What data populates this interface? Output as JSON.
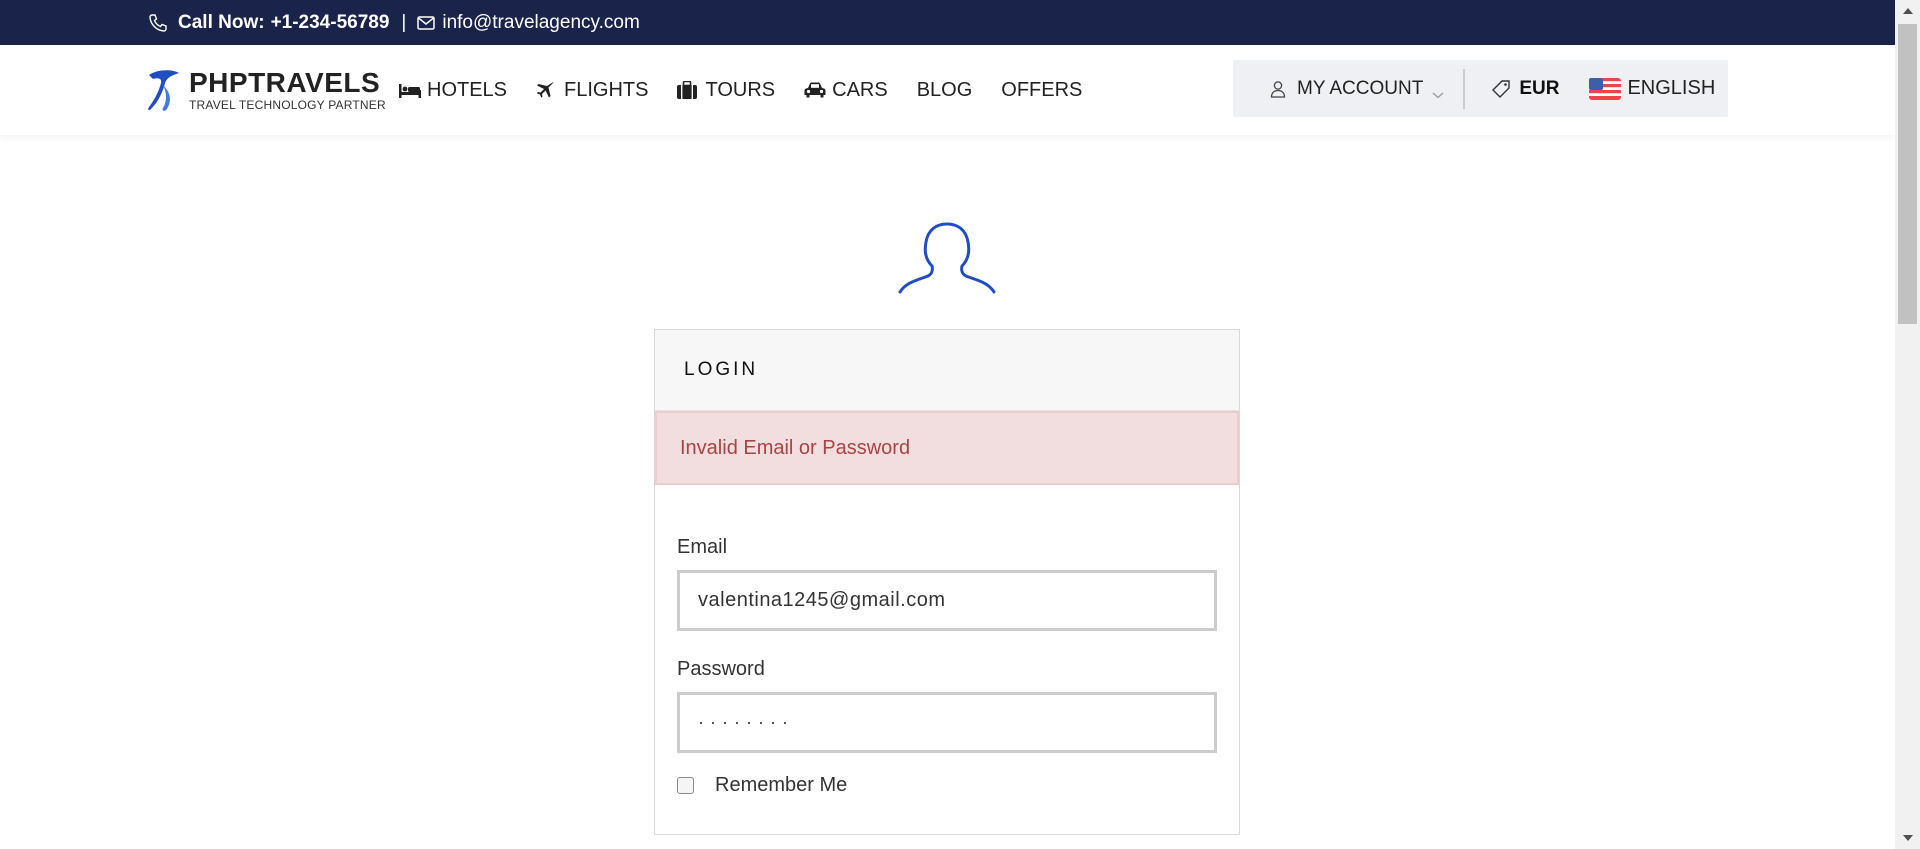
{
  "topbar": {
    "call_label": "Call Now:",
    "phone": "+1-234-56789",
    "separator": "|",
    "email": "info@travelagency.com"
  },
  "logo": {
    "name": "PHPTRAVELS",
    "tagline": "TRAVEL TECHNOLOGY PARTNER"
  },
  "nav": {
    "items": [
      {
        "label": "HOTELS",
        "icon": "bed-icon"
      },
      {
        "label": "FLIGHTS",
        "icon": "plane-icon"
      },
      {
        "label": "TOURS",
        "icon": "suitcase-icon"
      },
      {
        "label": "CARS",
        "icon": "car-icon"
      },
      {
        "label": "BLOG",
        "icon": ""
      },
      {
        "label": "OFFERS",
        "icon": ""
      }
    ]
  },
  "account": {
    "my_account": "MY ACCOUNT",
    "currency": "EUR",
    "language": "ENGLISH"
  },
  "login": {
    "title": "LOGIN",
    "error": "Invalid Email or Password",
    "email_label": "Email",
    "email_value": "valentina1245@gmail.com",
    "password_label": "Password",
    "password_value": "········",
    "remember_label": "Remember Me"
  },
  "colors": {
    "topbar_bg": "#1a244b",
    "brand_blue": "#1f4ec2",
    "alert_bg": "#f2dede",
    "alert_text": "#a94442"
  }
}
